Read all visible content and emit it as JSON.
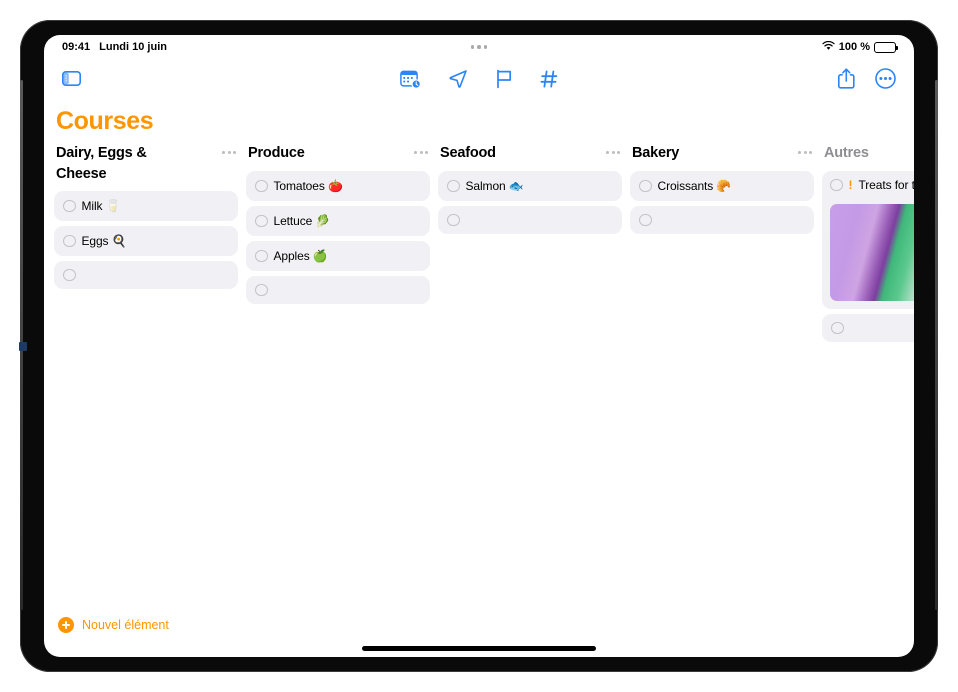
{
  "status_bar": {
    "time": "09:41",
    "date": "Lundi 10 juin",
    "wifi_icon": "wifi-icon",
    "battery_level": "100 %",
    "battery_icon": "battery-icon",
    "multitask_icon": "multitask-handle-icon"
  },
  "toolbar": {
    "sidebar_toggle_icon": "sidebar-toggle-icon",
    "center_items": [
      {
        "icon": "calendar-badge-icon",
        "label": "Date"
      },
      {
        "icon": "location-send-icon",
        "label": "Lieu"
      },
      {
        "icon": "flag-icon",
        "label": "Drapeau"
      },
      {
        "icon": "hashtag-icon",
        "label": "Tag"
      }
    ],
    "share_icon": "share-icon",
    "more_icon": "more-circle-icon"
  },
  "list": {
    "title": "Courses",
    "accent_color": "#ff9500",
    "columns": [
      {
        "title": "Dairy, Eggs & Cheese",
        "dimmed": false,
        "menu_icon": "ellipsis-icon",
        "items": [
          {
            "text": "Milk 🥛",
            "checked": false,
            "priority": ""
          },
          {
            "text": "Eggs 🍳",
            "checked": false,
            "priority": ""
          }
        ],
        "has_empty_row": true,
        "photo": false
      },
      {
        "title": "Produce",
        "dimmed": false,
        "menu_icon": "ellipsis-icon",
        "items": [
          {
            "text": "Tomatoes 🍅",
            "checked": false,
            "priority": ""
          },
          {
            "text": "Lettuce 🥬",
            "checked": false,
            "priority": ""
          },
          {
            "text": "Apples 🍏",
            "checked": false,
            "priority": ""
          }
        ],
        "has_empty_row": true,
        "photo": false
      },
      {
        "title": "Seafood",
        "dimmed": false,
        "menu_icon": "ellipsis-icon",
        "items": [
          {
            "text": "Salmon 🐟",
            "checked": false,
            "priority": ""
          }
        ],
        "has_empty_row": true,
        "photo": false
      },
      {
        "title": "Bakery",
        "dimmed": false,
        "menu_icon": "ellipsis-icon",
        "items": [
          {
            "text": "Croissants 🥐",
            "checked": false,
            "priority": ""
          }
        ],
        "has_empty_row": true,
        "photo": false
      },
      {
        "title": "Autres",
        "dimmed": true,
        "menu_icon": "",
        "items": [
          {
            "text": "Treats for t",
            "checked": false,
            "priority": "!"
          }
        ],
        "has_empty_row": true,
        "photo": true,
        "photo_name": "popsicle-photo-attachment"
      }
    ]
  },
  "footer": {
    "new_item_label": "Nouvel élément",
    "plus_icon": "plus-circle-icon"
  }
}
